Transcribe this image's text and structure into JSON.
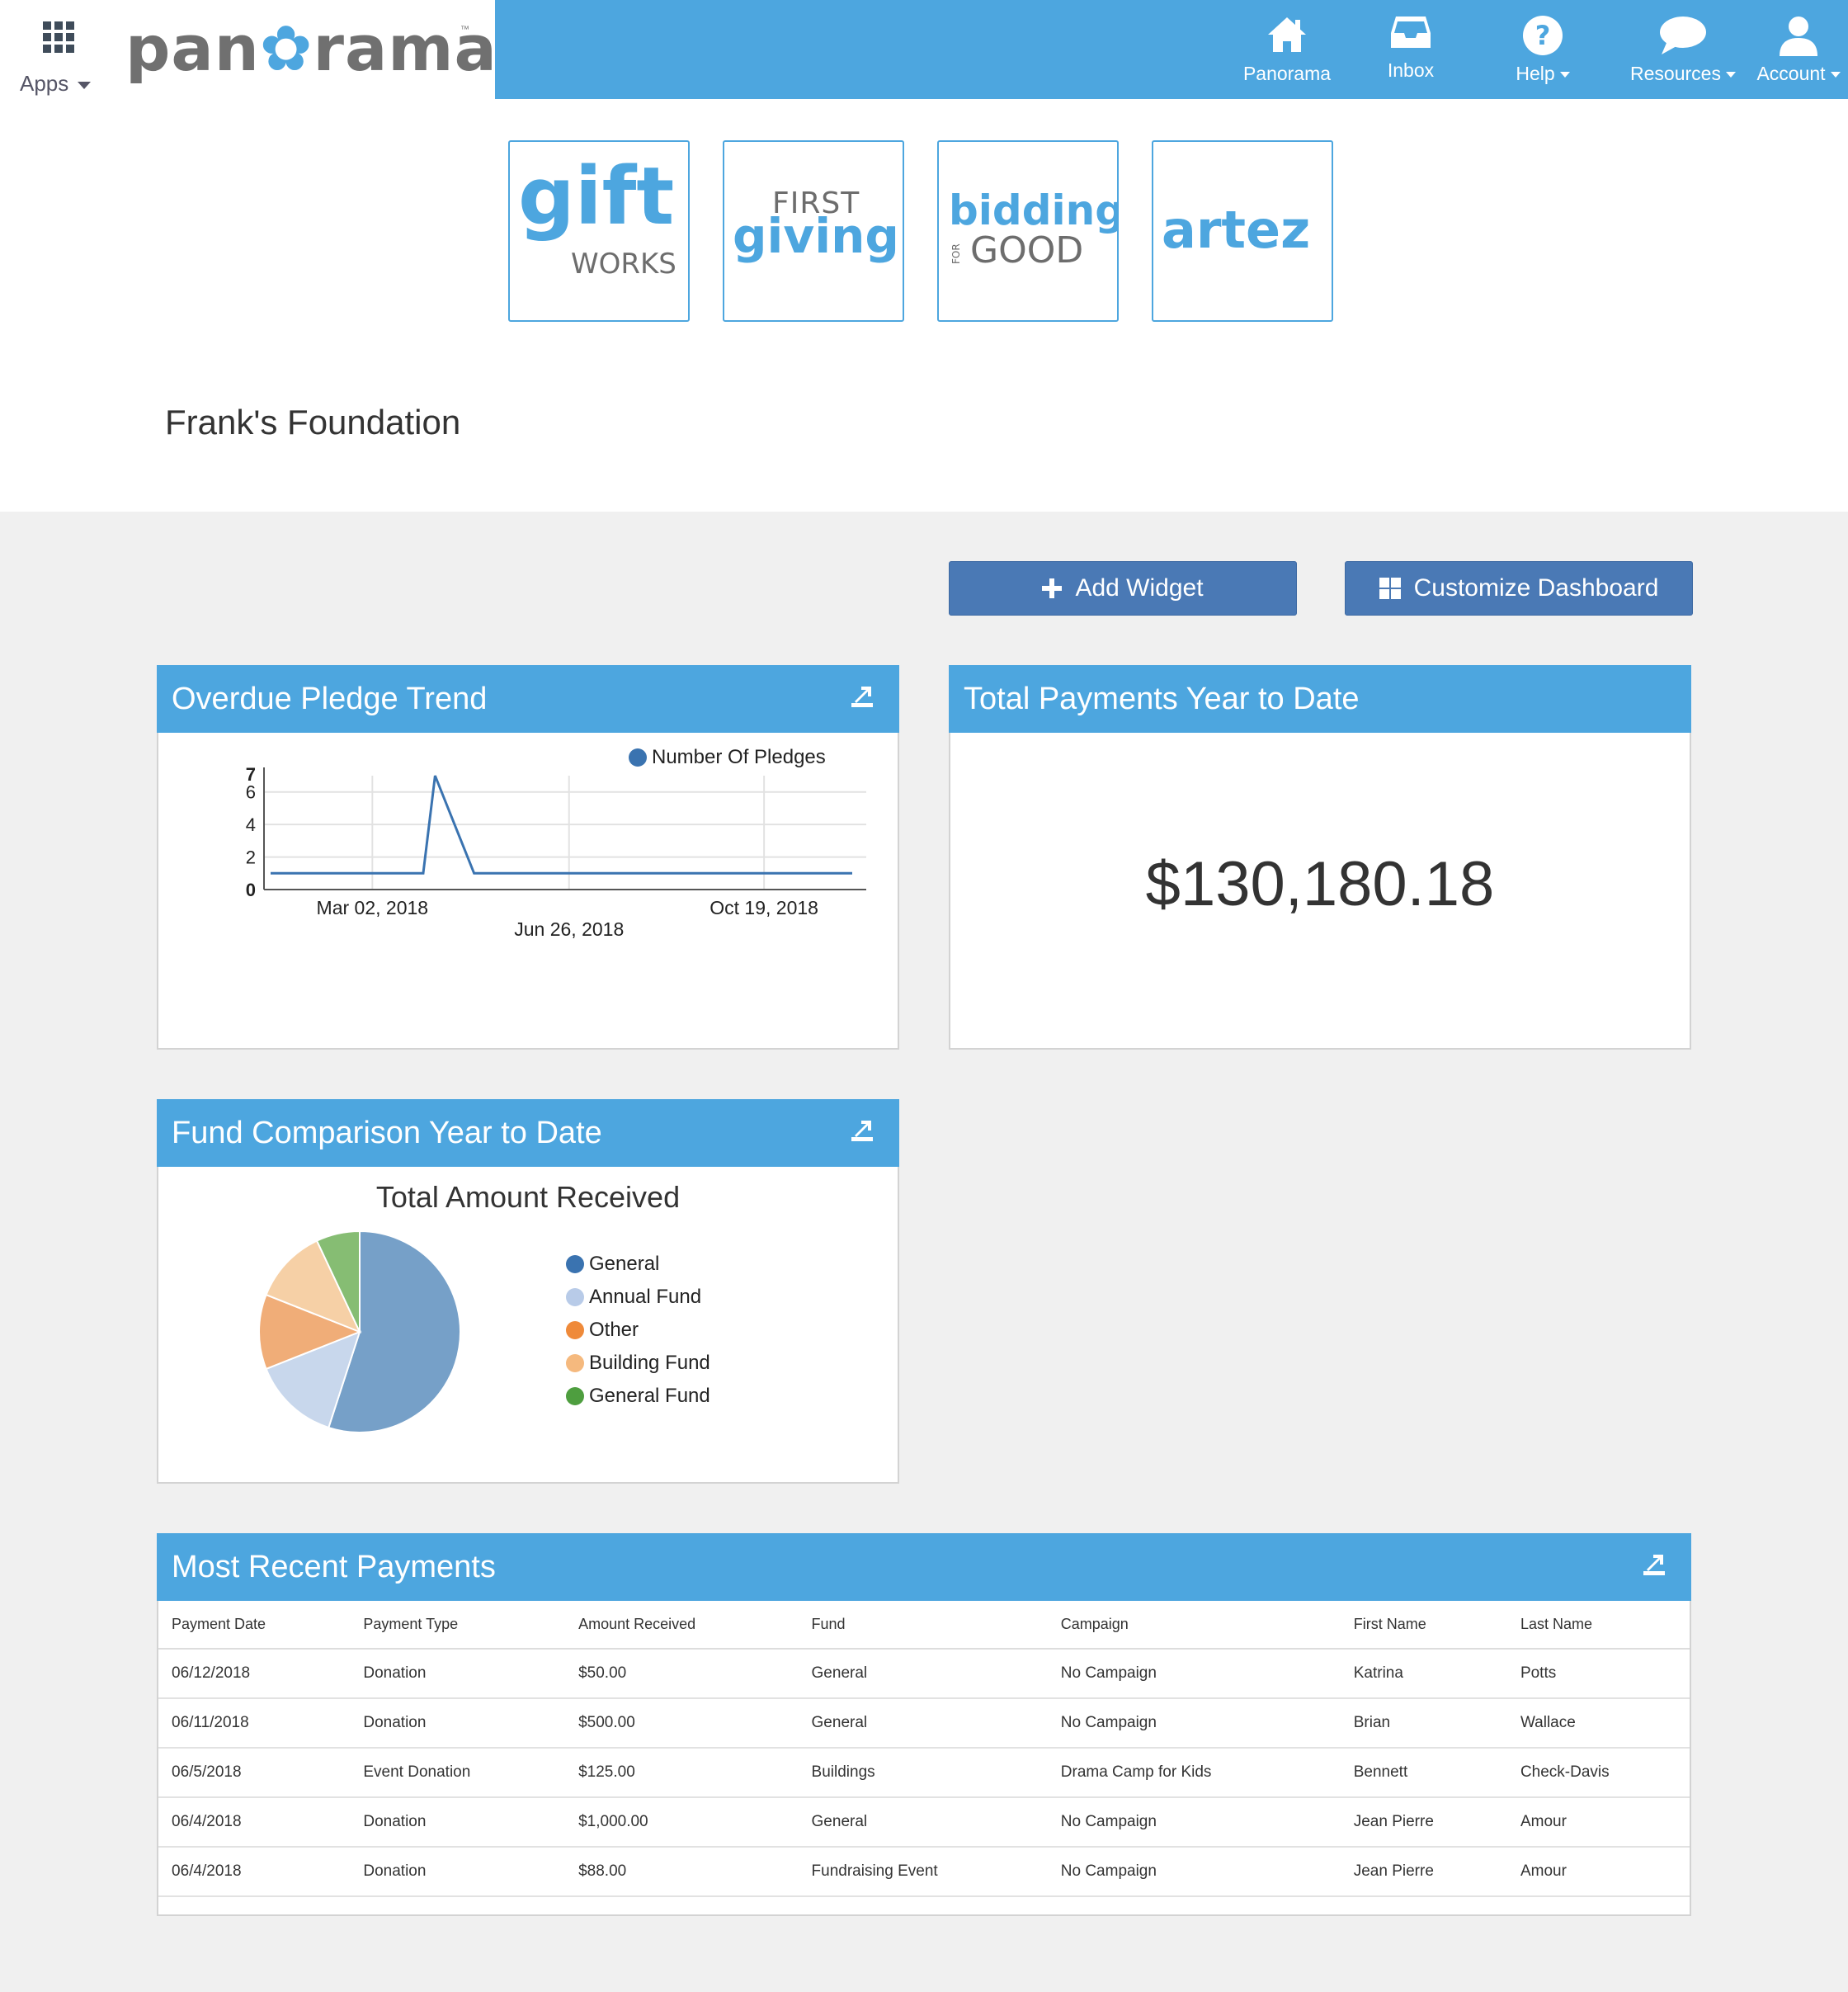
{
  "header": {
    "apps_label": "Apps",
    "logo_text_a": "pan",
    "logo_text_b": "rama",
    "logo_tm": "™",
    "nav": [
      {
        "label": "Panorama",
        "icon": "home-icon"
      },
      {
        "label": "Inbox",
        "icon": "inbox-icon"
      },
      {
        "label": "Help",
        "icon": "help-icon"
      },
      {
        "label": "Resources",
        "icon": "chat-bubble-icon"
      },
      {
        "label": "Account",
        "icon": "user-icon"
      }
    ]
  },
  "apps": [
    {
      "name": "giftWORKS",
      "line1": "gift",
      "line2": "WORKS"
    },
    {
      "name": "FirstGiving",
      "line1": "FIRST",
      "line2": "giving"
    },
    {
      "name": "BiddingForGood",
      "line1": "bidding",
      "line2": "GOOD",
      "line3": "FOR"
    },
    {
      "name": "artez",
      "line1": "artez"
    }
  ],
  "organization": "Frank's Foundation",
  "toolbar": {
    "add_widget": "Add Widget",
    "customize": "Customize Dashboard"
  },
  "widgets": {
    "pledge_trend": {
      "title": "Overdue Pledge Trend",
      "legend": "Number Of Pledges",
      "x_ticks": [
        "Mar 02, 2018",
        "Jun 26, 2018",
        "Oct 19, 2018"
      ],
      "y_ticks": [
        "0",
        "2",
        "4",
        "6",
        "7"
      ]
    },
    "total_payments": {
      "title": "Total Payments Year to Date",
      "amount": "$130,180.18"
    },
    "fund_comparison": {
      "title": "Fund Comparison Year to Date",
      "chart_title": "Total Amount Received"
    },
    "recent_payments": {
      "title": "Most Recent Payments",
      "columns": [
        "Payment Date",
        "Payment Type",
        "Amount Received",
        "Fund",
        "Campaign",
        "First Name",
        "Last Name"
      ],
      "rows": [
        [
          "06/12/2018",
          "Donation",
          "$50.00",
          "General",
          "No Campaign",
          "Katrina",
          "Potts"
        ],
        [
          "06/11/2018",
          "Donation",
          "$500.00",
          "General",
          "No Campaign",
          "Brian",
          "Wallace"
        ],
        [
          "06/5/2018",
          "Event Donation",
          "$125.00",
          "Buildings",
          "Drama Camp for Kids",
          "Bennett",
          "Check-Davis"
        ],
        [
          "06/4/2018",
          "Donation",
          "$1,000.00",
          "General",
          "No Campaign",
          "Jean Pierre",
          "Amour"
        ],
        [
          "06/4/2018",
          "Donation",
          "$88.00",
          "Fundraising Event",
          "No Campaign",
          "Jean Pierre",
          "Amour"
        ]
      ]
    }
  },
  "colors": {
    "brand_blue": "#4da6df",
    "button_blue": "#4a79b5",
    "line_blue": "#3a73b0"
  },
  "chart_data": [
    {
      "type": "line",
      "x": [
        "2018-01-01",
        "2018-03-02",
        "2018-04-01",
        "2018-04-08",
        "2018-05-01",
        "2018-06-26",
        "2018-10-19",
        "2018-12-10"
      ],
      "series": [
        {
          "name": "Number Of Pledges",
          "values": [
            1,
            1,
            1,
            7,
            1,
            1,
            1,
            1
          ]
        }
      ],
      "x_tick_labels": [
        "Mar 02, 2018",
        "Jun 26, 2018",
        "Oct 19, 2018"
      ],
      "ylim": [
        0,
        7
      ],
      "y_ticks": [
        0,
        2,
        4,
        6,
        7
      ],
      "grid": true,
      "legend": "top-right"
    },
    {
      "type": "pie",
      "title": "Total Amount Received",
      "categories": [
        "General",
        "Annual Fund",
        "Other",
        "Building Fund",
        "General Fund"
      ],
      "values": [
        55,
        14,
        12,
        12,
        7
      ],
      "colors": [
        "#76a0c8",
        "#c8d7ec",
        "#f0ad78",
        "#f6d0a6",
        "#86bd73"
      ],
      "legend_colors": [
        "#3a73b0",
        "#b8cbe8",
        "#ef8a3a",
        "#f5b97e",
        "#4e9e3f"
      ],
      "legend": "right"
    }
  ]
}
